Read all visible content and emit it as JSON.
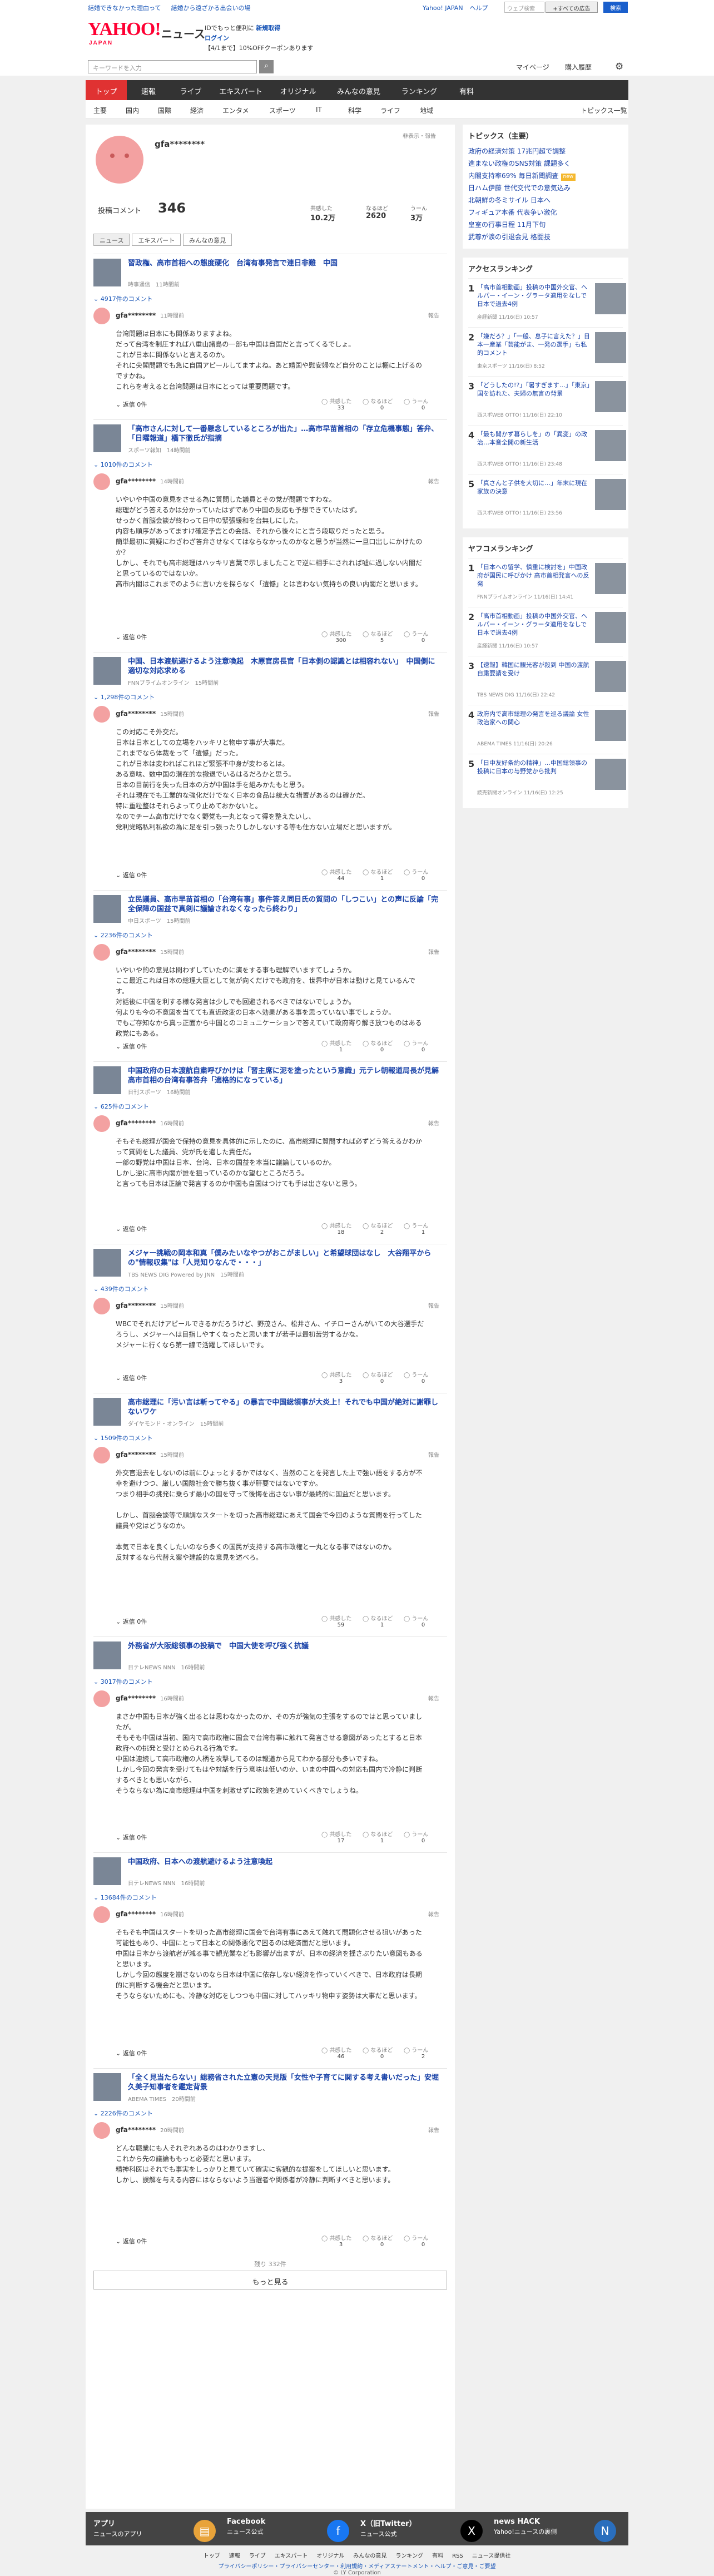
{
  "topbar": {
    "left_links": [
      "結婚できなかった理由って",
      "結婚から遠ざかる出会いの場"
    ],
    "right_links": [
      "Yahoo! JAPAN",
      "ヘルプ"
    ],
    "search_placeholder": "ウェブ検索",
    "search_btn": "+すべての広告",
    "help_btn": "検索"
  },
  "header": {
    "logo": "YAHOO!",
    "logo_sub": "JAPAN",
    "service": "ニュース",
    "promo_line1": "IDでもっと便利に",
    "promo_link1": "新規取得",
    "promo_line2": "ログイン",
    "promo_line3": "【4/1まで】10%OFFクーポンあります"
  },
  "search": {
    "placeholder": "キーワードを入力",
    "mypage": "マイページ",
    "koudoku": "購入履歴"
  },
  "gnav": [
    "トップ",
    "速報",
    "ライブ",
    "エキスパート",
    "オリジナル",
    "みんなの意見",
    "ランキング",
    "有料"
  ],
  "snav": [
    "主要",
    "国内",
    "国際",
    "経済",
    "エンタメ",
    "スポーツ",
    "IT",
    "科学",
    "ライフ",
    "地域"
  ],
  "snav_right": "トピックス一覧",
  "profile": {
    "name": "gfa********",
    "report": "非表示・報告",
    "post_label": "投稿コメント",
    "post_count": "346",
    "stats": [
      {
        "label": "共感した",
        "value": "10.2万"
      },
      {
        "label": "なるほど",
        "value": "2620"
      },
      {
        "label": "うーん",
        "value": "3万"
      }
    ],
    "tabs": [
      "ニュース",
      "エキスパート",
      "みんなの意見"
    ]
  },
  "reactions_labels": [
    "共感した",
    "なるほど",
    "うーん"
  ],
  "reply_label": "返信 0件",
  "report_label": "報告",
  "items": [
    {
      "title": "習政権、高市首相への態度硬化　台湾有事発言で連日非難　中国",
      "source": "時事通信",
      "time": "11時間前",
      "count": "4917件のコメント",
      "user": "gfa********",
      "ctime": "11時間前",
      "text": "台湾問題は日本にも関係ありますよね。\nだって台湾を制圧すれば八重山諸島の一部も中国は自国だと言ってくるでしょ。\nこれが日本に関係ないと言えるのか。\nそれに尖閣問題でも急に自国アピールしてますよね。あと靖国や慰安婦など自分のことは棚に上げるのですかね。\nこれらを考えると台湾問題は日本にとっては重要問題です。",
      "reply": "返信 0件",
      "r": [
        "33",
        "0",
        "0"
      ]
    },
    {
      "title": "「高市さんに対して一番懸念しているところが出た」…高市早苗首相の「存立危機事態」答弁、「日曜報道」橋下徹氏が指摘",
      "source": "スポーツ報知",
      "time": "14時間前",
      "count": "1010件のコメント",
      "user": "gfa********",
      "ctime": "14時間前",
      "text": "いやいや中国の意見をさせる為に質問した議員とその党が問題ですわな。\n総理がどう答えるかは分かっていたはずであり中国の反応も予想できていたはず。\nせっかく首脳会談が終わって日中の緊張緩和を台無しにした。\n内容も順序があってますけ確定予言との会話、それから後々にと言う段取りだったと思う。\n簡単最初に質疑にわざわざ答弁させなくてはならなかったのかなと思うが当然に一旦口出しにかけたのか？\nしかし、それでも高市総理はハッキリ言葉で示しましたことで逆に相手にされれば嘘に過しない内閣だと思っているのではないか。\n高市内閣はこれまでのように言い方を探らなく「遺憾」とは言わない気持ちの良い内閣だと思います。",
      "reply": "返信 0件",
      "r": [
        "300",
        "5",
        "0"
      ]
    },
    {
      "title": "中国、日本渡航避けるよう注意喚起　木原官房長官「日本側の認識とは相容れない」　中国側に適切な対応求める",
      "source": "FNNプライムオンライン",
      "time": "15時間前",
      "count": "1,298件のコメント",
      "user": "gfa********",
      "ctime": "15時間前",
      "text": "この対応こそ外交だ。\n日本は日本としての立場をハッキリと物申す事が大事だ。\nこれまでなら体裁をって「遺憾」だった。\nこれが日本は変わればこれほど緊張不中身が変わるとは。\nある意味、数中国の潜在的な撤退でいるはるだろかと思う。\n日本の目前行を失った日本の方が中国は手を組みかたもと思う。\nそれは現在でも工業的な強化だけでなく日本の食品は統大な措置があるのは確かだ。\n特に重粒整はそれらよってり止めておかないと。\nなのでチーム高市だけでなく野党も一丸となって得を整えたいし、\n党利党略私利私欲の為に足を引っ張ったりしかしないする等も仕方ない立場だと思いますが。",
      "reply": "返信 0件",
      "r": [
        "44",
        "1",
        "0"
      ]
    },
    {
      "title": "立民議員、高市早苗首相の「台湾有事」事件答え同日氏の質問の「しつこい」との声に反論「完全保障の国益で真剣に議論されなくなったら終わり」",
      "source": "中日スポーツ",
      "time": "15時間前",
      "count": "2236件のコメント",
      "user": "gfa********",
      "ctime": "15時間前",
      "text": "いやいや的の意見は問わずしていたのに演をする事も理解でいますてしょうか。\nここ最近これは日本の総理大臣として気が向くだけでも政府を、世界中が日本は動けと見ているんです。\n対話後に中国を利する様な発言は少しでも回避されるべきではないでしょうか。\n何よりも今の不意図を当てても直近政変の日本へ効果がある事を思っていない事でしょうか。\nでもご存知なから真っ正面から中国とのコミュニケーションで答えていて政府寄り解き放つものはある政党にもある。",
      "reply": "返信 0件",
      "r": [
        "1",
        "0",
        "0"
      ]
    },
    {
      "title": "中国政府の日本渡航自粛呼びかけは「習主席に泥を塗ったという意識」元テレ朝報道局長が見解　高市首相の台湾有事答弁「適格的になっている」",
      "source": "日刊スポーツ",
      "time": "16時間前",
      "count": "625件のコメント",
      "user": "gfa********",
      "ctime": "16時間前",
      "text": "そもそも総理が国会で保持の意見を具体的に示したのに、高市総理に質問すれば必ずどう答えるかわかって質問をした議員、党が氏を遣した責任だ。\n一部の野党は中国は日本、台湾、日本の国益を本当に議論しているのか。\nしかし逆に高市内閣が誰を狙っているのかな望むところだろう。\nと言っても日本は正論で発言するのか中国も自国はつけても手は出さないと思う。",
      "reply": "返信 0件",
      "r": [
        "18",
        "2",
        "1"
      ]
    },
    {
      "title": "メジャー挑戦の岡本和真「僕みたいなやつがおこがましい」と希望球団はなし　大谷翔平からの\"情報収集\"は「人見知りなんで・・・」",
      "source": "TBS NEWS DIG Powered by JNN",
      "time": "15時間前",
      "count": "439件のコメント",
      "user": "gfa********",
      "ctime": "15時間前",
      "text": "WBCでそれだけアピールできるかだろうけど、野茂さん、松井さん、イチローさんがいての大谷選手だろうし、メジャーへは目指しやすくなったと思いますが若手は最初苦労するかな。\nメジャーに行くなら第一線で活躍してほしいです。",
      "reply": "返信 0件",
      "r": [
        "3",
        "0",
        "0"
      ]
    },
    {
      "title": "高市総理に「污い言は斬ってやる」の暴言で中国総領事が大炎上！それでも中国が絶対に謝罪しないワケ",
      "source": "ダイヤモンド・オンライン",
      "time": "15時間前",
      "count": "1509件のコメント",
      "user": "gfa********",
      "ctime": "15時間前",
      "text": "外交官退去をしないのは前にひょっとするかではなく、当然のことを発言した上で強い語をする方が不幸を避けつつ、厳しい国際社会で勝ち抜く事が肝要ではないですか。\nつまり相手の挑発に乗らず最小の国を守って後悔を出さない事が最終的に国益だと思います。\n\nしかし、首脳会談等で順調なスタートを切った高市総理にあえて国会で今回のような質問を行ってした議員や党はどうなのか。\n\n本気で日本を良くしたいのなら多くの国民が支持する高市政権と一丸となる事ではないのか。\n反対するなら代替え案や建設的な意見を述べろ。",
      "reply": "返信 0件",
      "r": [
        "59",
        "1",
        "0"
      ]
    },
    {
      "title": "外務省が大阪総領事の投稿で　中国大使を呼び強く抗議",
      "source": "日テレNEWS NNN",
      "time": "16時間前",
      "count": "3017件のコメント",
      "user": "gfa********",
      "ctime": "16時間前",
      "text": "まさか中国も日本が強く出るとは思わなかったのか、その方が強気の主張をするのではと思っていましたが。\nそもそも中国は当初、国内で高市政権に国会で台湾有事に触れて発言させる意図があったとすると日本政府への挑発と受けとめられる行為です。\n中国は連続して高市政権の人柄を攻撃してるのは報道から見てわかる部分も多いですね。\nしかし今回の発言を受けてもはや対話を行う意味は低いのか、いまの中国への対応も国内で冷静に判断するべきとも思いながら、\nそうならない為に高市総理は中国を刺激せずに政策を進めていくべきでしょうね。",
      "reply": "返信 0件",
      "r": [
        "17",
        "1",
        "0"
      ]
    },
    {
      "title": "中国政府、日本への渡航避けるよう注意喚起",
      "source": "日テレNEWS NNN",
      "time": "16時間前",
      "count": "13684件のコメント",
      "user": "gfa********",
      "ctime": "16時間前",
      "text": "そもそも中国はスタートを切った高市総理に国会で台湾有事にあえて触れて問題化させる狙いがあった可能性もあり、中国にとって日本との関係悪化で困るのは経済面だと思います。\n中国は日本から渡航者が減る事で観光業なども影響が出ますが、日本の経済を揺さぶりたい意図もあると思います。\nしかし今回の態度を崩さないのなら日本は中国に依存しない経済を作っていくべきで、日本政府は長期的に判断する機会だと思います。\nそうならないためにも、冷静な対応をしつつも中国に対してハッキリ物申す姿勢は大事だと思います。",
      "reply": "返信 0件",
      "r": [
        "46",
        "0",
        "2"
      ]
    },
    {
      "title": "「全く見当たらない」総務省された立憲の天見版「女性や子育てに関する考え書いだった」安堀久美子知事者を鑑定背景",
      "source": "ABEMA TIMES",
      "time": "20時間前",
      "count": "2226件のコメント",
      "user": "gfa********",
      "ctime": "20時間前",
      "text": "どんな職業にも人それぞれあるのはわかりますし、\nこれから先の議論ももっと必要だと思います。\n精神科医はそれでも事実をしっかりと見ていて確実に客観的な提案をしてほしいと思います。\nしかし、誤解を与える内容にはならないよう当選者や関係者が冷静に判断すべきと思います。",
      "reply": "返信 0件",
      "r": [
        "3",
        "0",
        "0"
      ]
    }
  ],
  "list_footer": "残り 332件",
  "more_btn": "もっと見る",
  "side": {
    "topics_title": "トピックス（主要）",
    "topics": [
      "政府の経済対策 17兆円超で調整",
      "進まない政権のSNS対策 課題多く",
      "内閣支持率69% 毎日新聞調査",
      "日ハム伊藤 世代交代での意気込み",
      "北朝鮮の冬ミサイル 日本へ",
      "フィギュア本番 代表争い激化",
      "皇室の行事日程 11月下旬",
      "武尊が涙の引退会見 格闘技"
    ],
    "topics_badges": [
      "",
      "",
      "new",
      "",
      "",
      "",
      "",
      ""
    ],
    "access_title": "アクセスランキング",
    "access": [
      {
        "n": "1",
        "t": "「高市首相動画」投稿の中国外交官、ヘルパー・イーン・グラータ適用をなしで 日本で過去4例",
        "s": "産経新聞 11/16(日) 10:57"
      },
      {
        "n": "2",
        "t": "「嫌だろ？」「一般、息子に言えた？」日本一産業「芸能がま、一発の選手」も私的コメント",
        "s": "東京スポーツ 11/16(日) 8:52"
      },
      {
        "n": "3",
        "t": "「どうしたの!?」「暑すぎます…」「東京」国を訪れた、夫婦の無言の背景",
        "s": "西スポWEB OTTO! 11/16(日) 22:10"
      },
      {
        "n": "4",
        "t": "「最も聞かず暮らしを」の「異変」の政治…本音全開の新生活",
        "s": "西スポWEB OTTO! 11/16(日) 23:48"
      },
      {
        "n": "5",
        "t": "「真さんと子供を大切に…」年末に現在 家族の決意",
        "s": "西スポWEB OTTO! 11/16(日) 23:56"
      }
    ],
    "yafoo_title": "ヤフコメランキング",
    "yafoo": [
      {
        "n": "1",
        "t": "「日本への留学、慎重に検討を」中国政府が国民に呼びかけ 高市首相発言への反発",
        "s": "FNNプライムオンライン 11/16(日) 14:41"
      },
      {
        "n": "2",
        "t": "「高市首相動画」投稿の中国外交官、ヘルパー・イーン・グラータ適用をなしで 日本で過去4例",
        "s": "産経新聞 11/16(日) 10:57"
      },
      {
        "n": "3",
        "t": "【速報】韓国に観光客が殺到 中国の渡航自粛要請を受け",
        "s": "TBS NEWS DIG 11/16(日) 22:42"
      },
      {
        "n": "4",
        "t": "政府内で高市総理の発言を巡る議論 女性政治家への関心",
        "s": "ABEMA TIMES 11/16(日) 20:26"
      },
      {
        "n": "5",
        "t": "「日中友好条約の精神」…中国総領事の投稿に日本の与野党から批判",
        "s": "読売新聞オンライン 11/16(日) 12:25"
      }
    ]
  },
  "footer": {
    "boxes": [
      {
        "t": "アプリ",
        "d": "ニュースのアプリ"
      },
      {
        "t": "Facebook",
        "d": "ニュース公式"
      },
      {
        "t": "X（旧Twitter）",
        "d": "ニュース公式"
      },
      {
        "t": "news HACK",
        "d": "Yahoo!ニュースの裏側"
      }
    ],
    "nav": [
      "トップ",
      "速報",
      "ライブ",
      "エキスパート",
      "オリジナル",
      "みんなの意見",
      "ランキング",
      "有料",
      "RSS",
      "ニュース提供社"
    ],
    "legal": "プライバシーポリシー・プライバシーセンター・利用規約・メディアステートメント・ヘルプ・ご意見・ご要望",
    "copyright": "© LY Corporation"
  }
}
